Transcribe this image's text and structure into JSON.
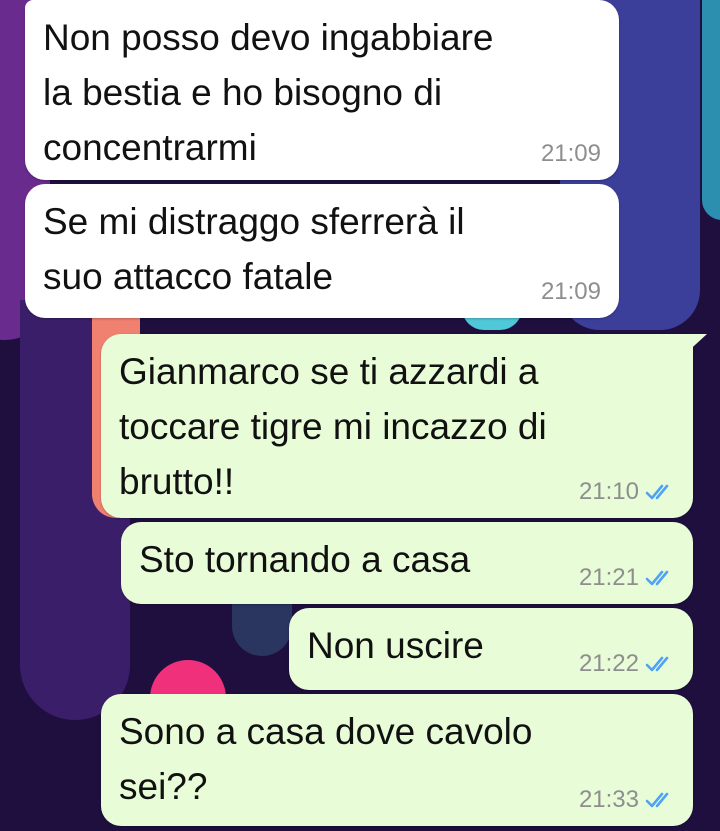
{
  "colors": {
    "incoming_bubble": "#ffffff",
    "outgoing_bubble": "#e8fcd8",
    "timestamp": "#8e8e8e",
    "read_ticks": "#4fa3f7",
    "wallpaper_background": "#1e0f3f"
  },
  "messages": [
    {
      "direction": "incoming",
      "text": "Non posso devo ingabbiare\nla bestia e ho bisogno di\nconcentrarmi",
      "time": "21:09"
    },
    {
      "direction": "incoming",
      "text": "Se mi distraggo sferrerà il\nsuo attacco fatale",
      "time": "21:09"
    },
    {
      "direction": "outgoing",
      "text": "Gianmarco se ti azzardi a\ntoccare tigre mi incazzo di\nbrutto!!",
      "time": "21:10",
      "status_icon": "double-check-read-icon"
    },
    {
      "direction": "outgoing",
      "text": "Sto tornando a casa",
      "time": "21:21",
      "status_icon": "double-check-read-icon"
    },
    {
      "direction": "outgoing",
      "text": "Non uscire",
      "time": "21:22",
      "status_icon": "double-check-read-icon"
    },
    {
      "direction": "outgoing",
      "text": "Sono a casa dove cavolo\nsei??",
      "time": "21:33",
      "status_icon": "double-check-read-icon"
    }
  ]
}
